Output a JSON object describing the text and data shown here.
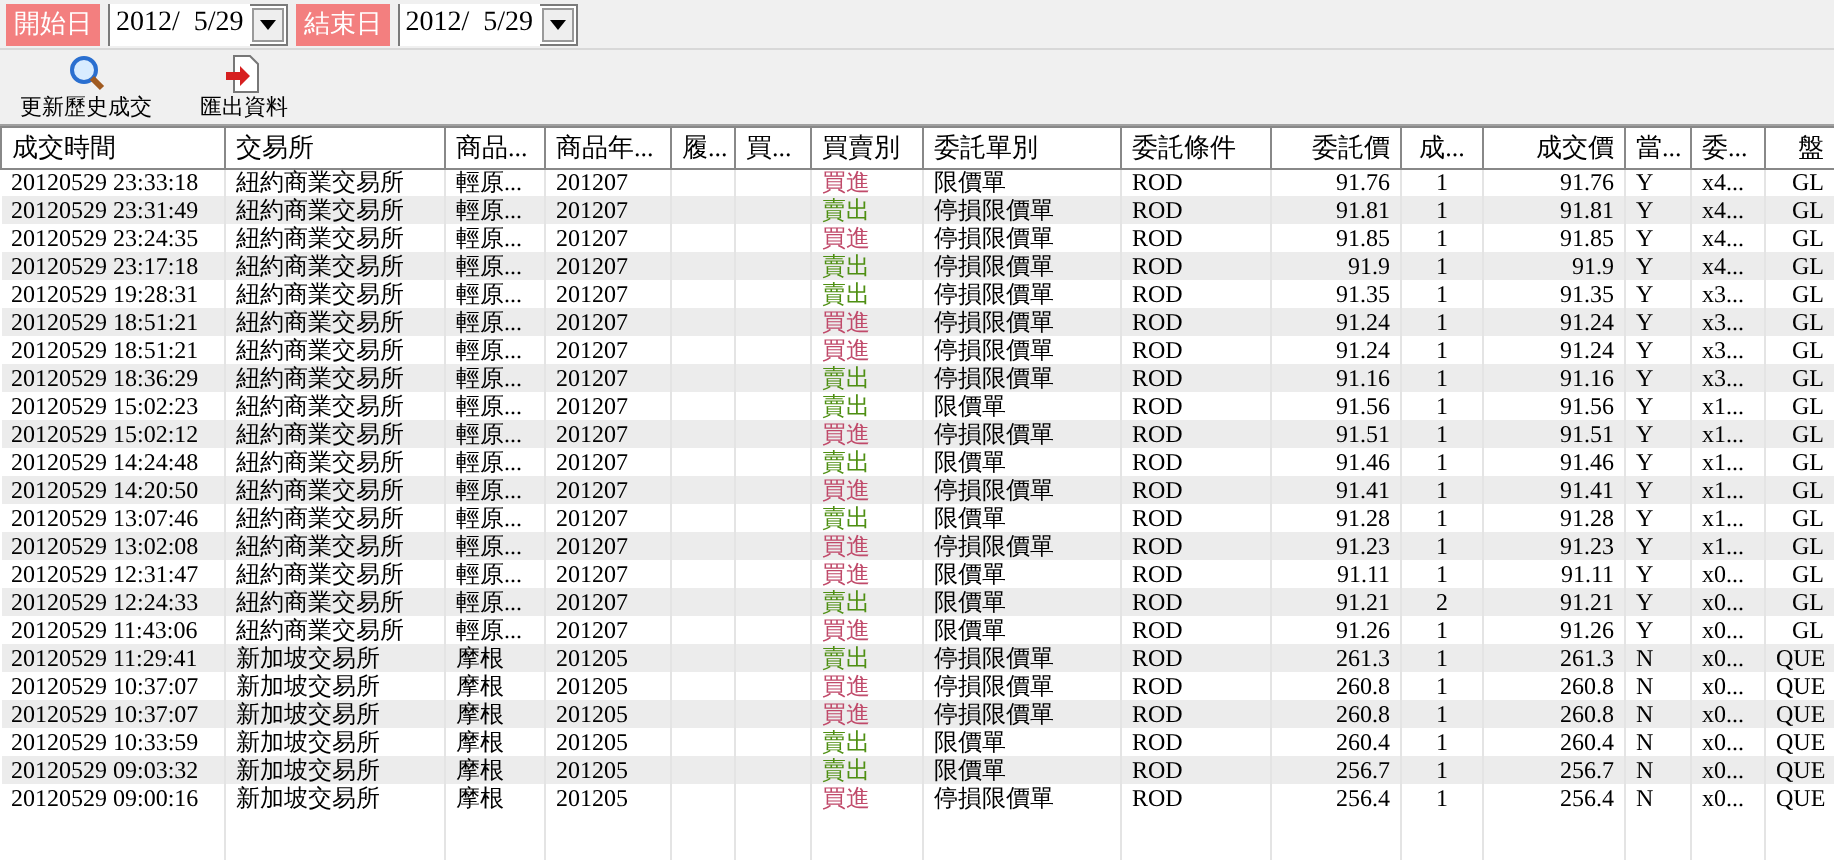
{
  "filters": [
    {
      "label": "開始日",
      "value": "2012/  5/29"
    },
    {
      "label": "結束日",
      "value": "2012/  5/29"
    }
  ],
  "toolbar": [
    {
      "label": "更新歷史成交"
    },
    {
      "label": "匯出資料"
    }
  ],
  "table": {
    "columns": [
      "成交時間",
      "交易所",
      "商品...",
      "商品年...",
      "履...",
      "買...",
      "買賣別",
      "委託單別",
      "委託條件",
      "委託價",
      "成...",
      "成交價",
      "當...",
      "委...",
      "盤"
    ],
    "rows": [
      {
        "kind": "buy",
        "cells": [
          "20120529 23:33:18",
          "紐約商業交易所",
          "輕原...",
          "201207",
          null,
          null,
          "買進",
          "限價單",
          "ROD",
          "91.76",
          "1",
          "91.76",
          "Y",
          "x4...",
          "GL"
        ]
      },
      {
        "kind": "sell",
        "cells": [
          "20120529 23:31:49",
          "紐約商業交易所",
          "輕原...",
          "201207",
          null,
          null,
          "賣出",
          "停損限價單",
          "ROD",
          "91.81",
          "1",
          "91.81",
          "Y",
          "x4...",
          "GL"
        ]
      },
      {
        "kind": "buy",
        "cells": [
          "20120529 23:24:35",
          "紐約商業交易所",
          "輕原...",
          "201207",
          null,
          null,
          "買進",
          "停損限價單",
          "ROD",
          "91.85",
          "1",
          "91.85",
          "Y",
          "x4...",
          "GL"
        ]
      },
      {
        "kind": "sell",
        "cells": [
          "20120529 23:17:18",
          "紐約商業交易所",
          "輕原...",
          "201207",
          null,
          null,
          "賣出",
          "停損限價單",
          "ROD",
          "91.9",
          "1",
          "91.9",
          "Y",
          "x4...",
          "GL"
        ]
      },
      {
        "kind": "sell",
        "cells": [
          "20120529 19:28:31",
          "紐約商業交易所",
          "輕原...",
          "201207",
          null,
          null,
          "賣出",
          "停損限價單",
          "ROD",
          "91.35",
          "1",
          "91.35",
          "Y",
          "x3...",
          "GL"
        ]
      },
      {
        "kind": "buy",
        "cells": [
          "20120529 18:51:21",
          "紐約商業交易所",
          "輕原...",
          "201207",
          null,
          null,
          "買進",
          "停損限價單",
          "ROD",
          "91.24",
          "1",
          "91.24",
          "Y",
          "x3...",
          "GL"
        ]
      },
      {
        "kind": "buy",
        "cells": [
          "20120529 18:51:21",
          "紐約商業交易所",
          "輕原...",
          "201207",
          null,
          null,
          "買進",
          "停損限價單",
          "ROD",
          "91.24",
          "1",
          "91.24",
          "Y",
          "x3...",
          "GL"
        ]
      },
      {
        "kind": "sell",
        "cells": [
          "20120529 18:36:29",
          "紐約商業交易所",
          "輕原...",
          "201207",
          null,
          null,
          "賣出",
          "停損限價單",
          "ROD",
          "91.16",
          "1",
          "91.16",
          "Y",
          "x3...",
          "GL"
        ]
      },
      {
        "kind": "sell",
        "cells": [
          "20120529 15:02:23",
          "紐約商業交易所",
          "輕原...",
          "201207",
          null,
          null,
          "賣出",
          "限價單",
          "ROD",
          "91.56",
          "1",
          "91.56",
          "Y",
          "x1...",
          "GL"
        ]
      },
      {
        "kind": "buy",
        "cells": [
          "20120529 15:02:12",
          "紐約商業交易所",
          "輕原...",
          "201207",
          null,
          null,
          "買進",
          "停損限價單",
          "ROD",
          "91.51",
          "1",
          "91.51",
          "Y",
          "x1...",
          "GL"
        ]
      },
      {
        "kind": "sell",
        "cells": [
          "20120529 14:24:48",
          "紐約商業交易所",
          "輕原...",
          "201207",
          null,
          null,
          "賣出",
          "限價單",
          "ROD",
          "91.46",
          "1",
          "91.46",
          "Y",
          "x1...",
          "GL"
        ]
      },
      {
        "kind": "buy",
        "cells": [
          "20120529 14:20:50",
          "紐約商業交易所",
          "輕原...",
          "201207",
          null,
          null,
          "買進",
          "停損限價單",
          "ROD",
          "91.41",
          "1",
          "91.41",
          "Y",
          "x1...",
          "GL"
        ]
      },
      {
        "kind": "sell",
        "cells": [
          "20120529 13:07:46",
          "紐約商業交易所",
          "輕原...",
          "201207",
          null,
          null,
          "賣出",
          "限價單",
          "ROD",
          "91.28",
          "1",
          "91.28",
          "Y",
          "x1...",
          "GL"
        ]
      },
      {
        "kind": "buy",
        "cells": [
          "20120529 13:02:08",
          "紐約商業交易所",
          "輕原...",
          "201207",
          null,
          null,
          "買進",
          "停損限價單",
          "ROD",
          "91.23",
          "1",
          "91.23",
          "Y",
          "x1...",
          "GL"
        ]
      },
      {
        "kind": "buy",
        "cells": [
          "20120529 12:31:47",
          "紐約商業交易所",
          "輕原...",
          "201207",
          null,
          null,
          "買進",
          "限價單",
          "ROD",
          "91.11",
          "1",
          "91.11",
          "Y",
          "x0...",
          "GL"
        ]
      },
      {
        "kind": "sell",
        "cells": [
          "20120529 12:24:33",
          "紐約商業交易所",
          "輕原...",
          "201207",
          null,
          null,
          "賣出",
          "限價單",
          "ROD",
          "91.21",
          "2",
          "91.21",
          "Y",
          "x0...",
          "GL"
        ]
      },
      {
        "kind": "buy",
        "cells": [
          "20120529 11:43:06",
          "紐約商業交易所",
          "輕原...",
          "201207",
          null,
          null,
          "買進",
          "限價單",
          "ROD",
          "91.26",
          "1",
          "91.26",
          "Y",
          "x0...",
          "GL"
        ]
      },
      {
        "kind": "sell",
        "cells": [
          "20120529 11:29:41",
          "新加坡交易所",
          "摩根",
          "201205",
          null,
          null,
          "賣出",
          "停損限價單",
          "ROD",
          "261.3",
          "1",
          "261.3",
          "N",
          "x0...",
          "QUE"
        ]
      },
      {
        "kind": "buy",
        "cells": [
          "20120529 10:37:07",
          "新加坡交易所",
          "摩根",
          "201205",
          null,
          null,
          "買進",
          "停損限價單",
          "ROD",
          "260.8",
          "1",
          "260.8",
          "N",
          "x0...",
          "QUE"
        ]
      },
      {
        "kind": "buy",
        "cells": [
          "20120529 10:37:07",
          "新加坡交易所",
          "摩根",
          "201205",
          null,
          null,
          "買進",
          "停損限價單",
          "ROD",
          "260.8",
          "1",
          "260.8",
          "N",
          "x0...",
          "QUE"
        ]
      },
      {
        "kind": "sell",
        "cells": [
          "20120529 10:33:59",
          "新加坡交易所",
          "摩根",
          "201205",
          null,
          null,
          "賣出",
          "限價單",
          "ROD",
          "260.4",
          "1",
          "260.4",
          "N",
          "x0...",
          "QUE"
        ]
      },
      {
        "kind": "sell",
        "cells": [
          "20120529 09:03:32",
          "新加坡交易所",
          "摩根",
          "201205",
          null,
          null,
          "賣出",
          "限價單",
          "ROD",
          "256.7",
          "1",
          "256.7",
          "N",
          "x0...",
          "QUE"
        ]
      },
      {
        "kind": "buy",
        "cells": [
          "20120529 09:00:16",
          "新加坡交易所",
          "摩根",
          "201205",
          null,
          null,
          "買進",
          "停損限價單",
          "ROD",
          "256.4",
          "1",
          "256.4",
          "N",
          "x0...",
          "QUE"
        ]
      }
    ]
  }
}
